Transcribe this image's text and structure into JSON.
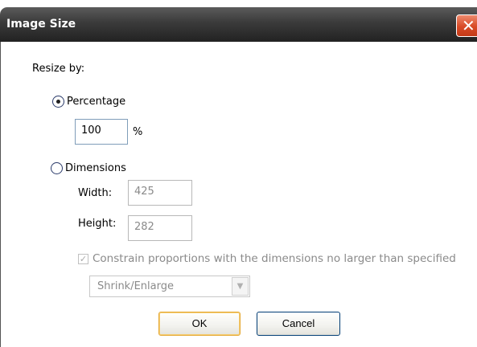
{
  "window": {
    "title": "Image Size",
    "close_glyph": "✕"
  },
  "resize_by_label": "Resize by:",
  "percentage": {
    "label": "Percentage",
    "selected": true,
    "value": "100",
    "unit": "%"
  },
  "dimensions": {
    "label": "Dimensions",
    "selected": false,
    "width_label": "Width:",
    "width_value": "425",
    "height_label": "Height:",
    "height_value": "282"
  },
  "constrain": {
    "label": "Constrain proportions with the dimensions no larger than specified",
    "checked": true,
    "check_glyph": "✓"
  },
  "mode_select": {
    "value": "Shrink/Enlarge",
    "arrow_glyph": "▼"
  },
  "buttons": {
    "ok": "OK",
    "cancel": "Cancel"
  },
  "colors": {
    "title_bar": "#3a3a3a",
    "close_button": "#d84a26",
    "default_button_highlight": "#e5a72f"
  }
}
